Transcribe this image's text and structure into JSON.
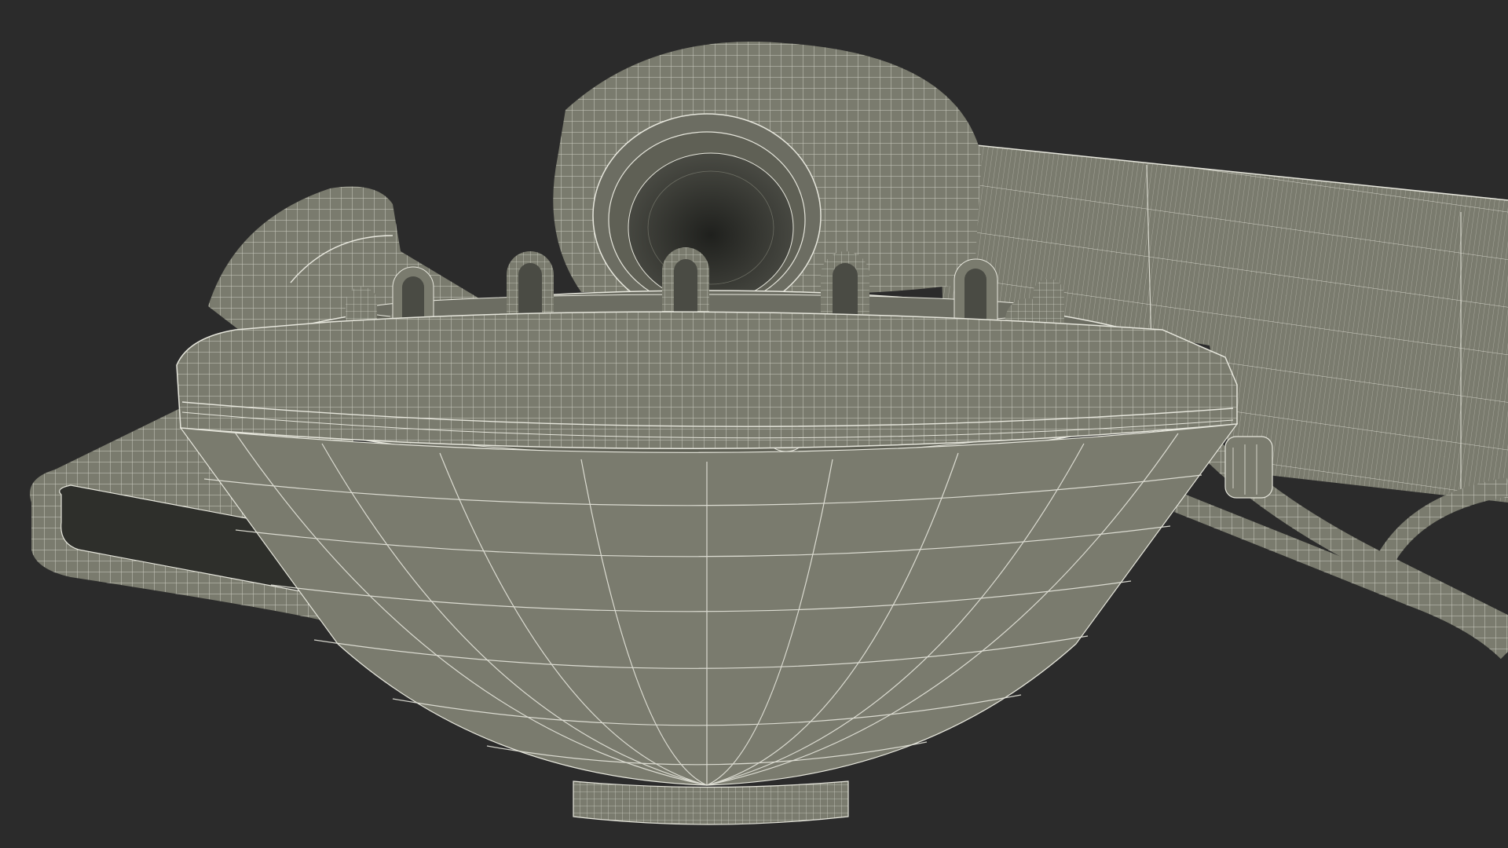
{
  "scene": {
    "background": "#2b2b2b",
    "shell_color": "#7a7b6e",
    "shell_dark": "#5f6055",
    "shell_light": "#8c8d80",
    "wire_color": "#e6e6dc",
    "cavity_color": "#2e2f2b",
    "parts": {
      "dryer_body": "hair-dryer-body",
      "dryer_handle": "hair-dryer-handle",
      "diffuser": "diffuser-attachment",
      "concentrator": "concentrator-nozzle",
      "side_attachment": "smoothing-attachment",
      "power_cord": "power-cord"
    }
  }
}
